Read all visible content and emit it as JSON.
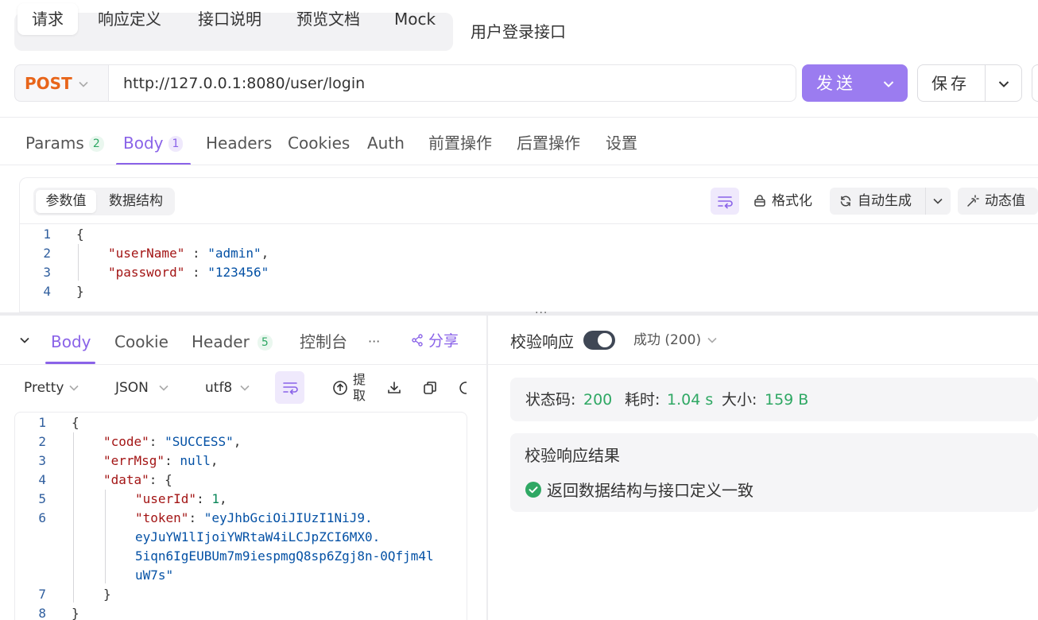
{
  "top_tabs": {
    "items": [
      {
        "label": "请求",
        "active": true
      },
      {
        "label": "响应定义"
      },
      {
        "label": "接口说明"
      },
      {
        "label": "预览文档"
      },
      {
        "label": "Mock"
      }
    ],
    "api_name": "用户登录接口"
  },
  "url_bar": {
    "method": "POST",
    "url": "http://127.0.0.1:8080/user/login",
    "send_label": "发送",
    "save_label": "保存"
  },
  "request_tabs": [
    {
      "label": "Params",
      "badge": "2"
    },
    {
      "label": "Body",
      "badge": "1",
      "active": true
    },
    {
      "label": "Headers"
    },
    {
      "label": "Cookies"
    },
    {
      "label": "Auth"
    },
    {
      "label": "前置操作"
    },
    {
      "label": "后置操作"
    },
    {
      "label": "设置"
    }
  ],
  "body_editor": {
    "segments": [
      "参数值",
      "数据结构"
    ],
    "format_label": "格式化",
    "auto_gen_label": "自动生成",
    "dynamic_label": "动态值",
    "lines": [
      "1",
      "2",
      "3",
      "4"
    ],
    "json": {
      "key1": "\"userName\"",
      "val1": "\"admin\"",
      "key2": "\"password\"",
      "val2": "\"123456\""
    }
  },
  "response": {
    "tabs": [
      {
        "label": "Body",
        "active": true
      },
      {
        "label": "Cookie"
      },
      {
        "label": "Header",
        "badge": "5"
      },
      {
        "label": "控制台"
      }
    ],
    "more": "···",
    "share_label": "分享",
    "format_select": "Pretty",
    "type_select": "JSON",
    "encoding_select": "utf8",
    "extract_label_1": "提",
    "extract_label_2": "取",
    "lines": [
      "1",
      "2",
      "3",
      "4",
      "5",
      "6",
      "7",
      "8"
    ],
    "json": {
      "code_key": "\"code\"",
      "code_val": "\"SUCCESS\"",
      "err_key": "\"errMsg\"",
      "err_val": "null",
      "data_key": "\"data\"",
      "uid_key": "\"userId\"",
      "uid_val": "1",
      "token_key": "\"token\"",
      "token_l1": "\"eyJhbGciOiJIUzI1NiJ9.",
      "token_l2": "eyJuYW1lIjoiYWRtaW4iLCJpZCI6MX0.",
      "token_l3": "5iqn6IgEUBUm7m9iespmgQ8sp6Zgj8n-0Qfjm4l",
      "token_l4": "uW7s\""
    }
  },
  "validation": {
    "label": "校验响应",
    "status_select": "成功 (200)",
    "status_code_label": "状态码:",
    "status_code": "200",
    "time_label": "耗时:",
    "time": "1.04 s",
    "size_label": "大小:",
    "size": "159 B",
    "result_title": "校验响应结果",
    "result_text": "返回数据结构与接口定义一致"
  },
  "colors": {
    "accent": "#8a63e8",
    "send_button": "#9b7cf0",
    "method": "#e8651a",
    "success": "#2fa864"
  }
}
